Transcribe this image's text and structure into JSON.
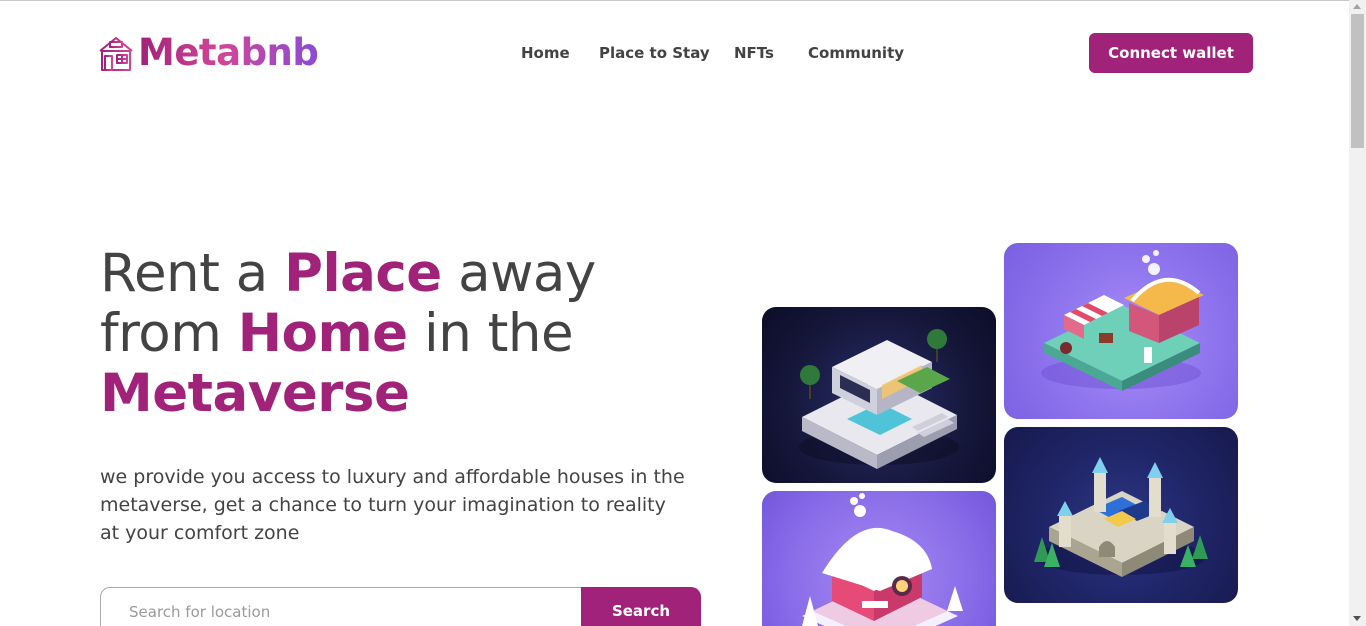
{
  "brand": {
    "name": "Metabnb",
    "icon": "house-icon",
    "accent": "#a02279"
  },
  "nav": {
    "items": [
      "Home",
      "Place to Stay",
      "NFTs",
      "Community"
    ]
  },
  "header": {
    "connect_label": "Connect wallet"
  },
  "hero": {
    "title_parts": [
      "Rent a ",
      "Place",
      " away from ",
      "Home",
      " in the ",
      "Metaverse"
    ],
    "subtitle": "we provide you access to luxury and affordable houses in the metaverse, get a chance to turn your imagination to reality at your comfort zone"
  },
  "search": {
    "placeholder": "Search for location",
    "button_label": "Search"
  },
  "tiles": [
    {
      "icon": "modern-villa-image"
    },
    {
      "icon": "market-stall-image"
    },
    {
      "icon": "castle-image"
    },
    {
      "icon": "snow-cottage-image"
    }
  ]
}
